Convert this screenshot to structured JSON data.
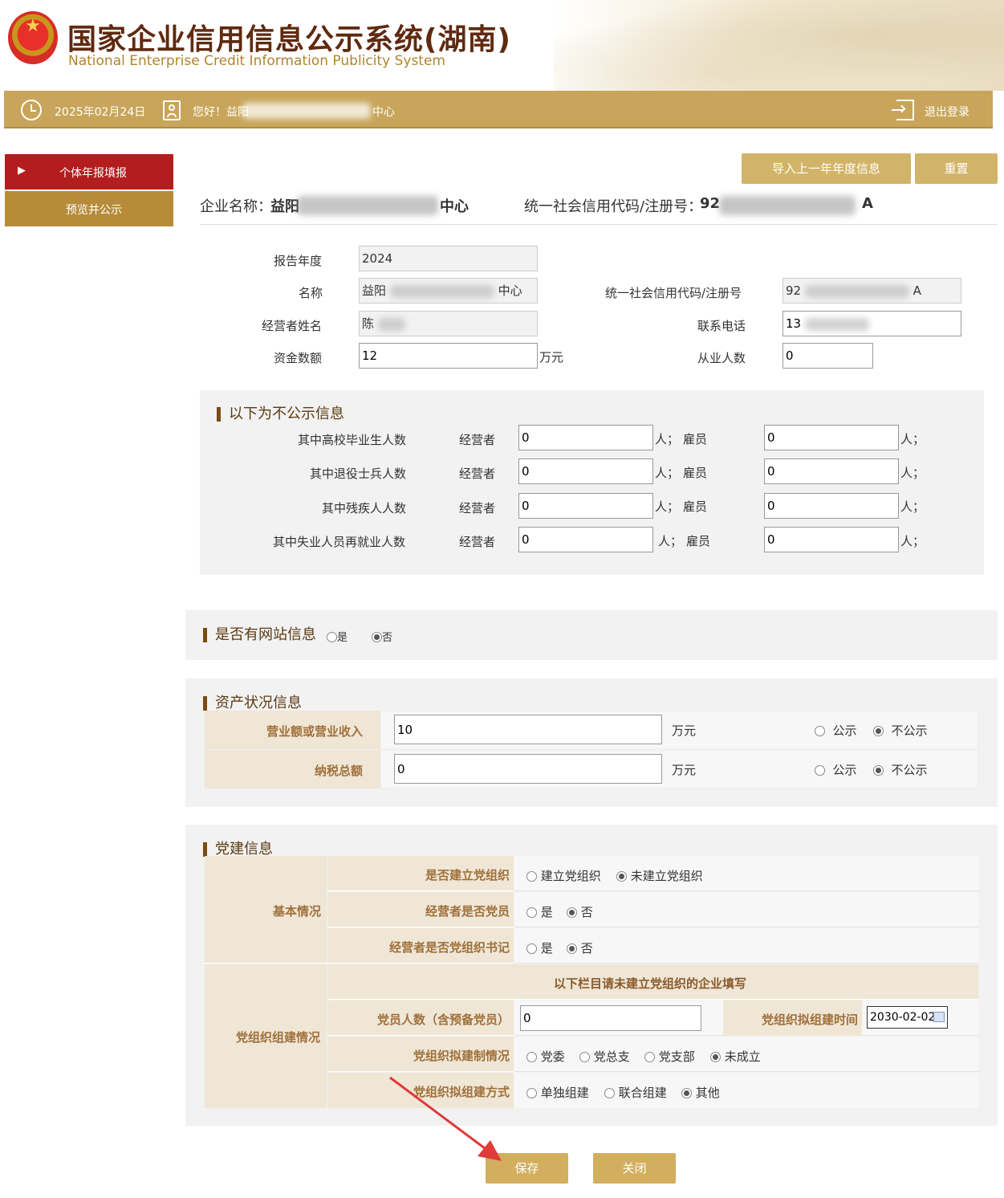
{
  "header": {
    "title_cn": "国家企业信用信息公示系统(湖南)",
    "title_en": "National Enterprise Credit Information Publicity System"
  },
  "topbar": {
    "date": "2025年02月24日",
    "greeting_prefix": "您好！益阳",
    "greeting_suffix": "中心",
    "logout": "退出登录"
  },
  "sidebar": {
    "items": [
      {
        "label": "个体年报填报"
      },
      {
        "label": "预览并公示"
      }
    ]
  },
  "actions": {
    "import_prev": "导入上一年年度信息",
    "reset": "重置",
    "save": "保存",
    "close": "关闭"
  },
  "entity": {
    "name_label": "企业名称：",
    "name_prefix": "益阳",
    "name_suffix": "中心",
    "code_label": "统一社会信用代码/注册号：",
    "code_prefix": "92",
    "code_suffix": "A"
  },
  "form": {
    "report_year_label": "报告年度",
    "report_year": "2024",
    "name_label": "名称",
    "name_prefix": "益阳",
    "name_suffix": "中心",
    "code_label": "统一社会信用代码/注册号",
    "code_prefix": "92",
    "code_suffix": "A",
    "operator_label": "经营者姓名",
    "operator_value": "陈",
    "phone_label": "联系电话",
    "phone_value": "13",
    "capital_label": "资金数额",
    "capital_value": "12",
    "capital_unit": "万元",
    "employees_label": "从业人数",
    "employees_value": "0"
  },
  "non_public": {
    "title": "以下为不公示信息",
    "operator_label": "经营者",
    "unit_sep": "人；",
    "employee_label": "雇员",
    "unit_end": "人；",
    "rows": [
      {
        "label": "其中高校毕业生人数",
        "operator": "0",
        "employee": "0"
      },
      {
        "label": "其中退役士兵人数",
        "operator": "0",
        "employee": "0"
      },
      {
        "label": "其中残疾人人数",
        "operator": "0",
        "employee": "0"
      },
      {
        "label": "其中失业人员再就业人数",
        "operator": "0",
        "employee": "0"
      }
    ]
  },
  "website": {
    "title": "是否有网站信息",
    "yes": "是",
    "no": "否",
    "selected": "否"
  },
  "assets": {
    "title": "资产状况信息",
    "unit": "万元",
    "public": "公示",
    "not_public": "不公示",
    "rows": [
      {
        "label": "营业额或营业收入",
        "value": "10",
        "selected": "不公示"
      },
      {
        "label": "纳税总额",
        "value": "0",
        "selected": "不公示"
      }
    ]
  },
  "party": {
    "title": "党建信息",
    "basic_label": "基本情况",
    "org_label": "党组织组建情况",
    "established_label": "是否建立党组织",
    "established_opts": [
      "建立党组织",
      "未建立党组织"
    ],
    "established_selected": "未建立党组织",
    "is_member_label": "经营者是否党员",
    "is_secretary_label": "经营者是否党组织书记",
    "yes": "是",
    "no": "否",
    "is_member_selected": "否",
    "is_secretary_selected": "否",
    "notice": "以下栏目请未建立党组织的企业填写",
    "members_label": "党员人数（含预备党员）",
    "members_value": "0",
    "plan_time_label": "党组织拟组建时间",
    "plan_time_value": "2030-02-02",
    "plan_type_label": "党组织拟建制情况",
    "plan_type_opts": [
      "党委",
      "党总支",
      "党支部",
      "未成立"
    ],
    "plan_type_selected": "未成立",
    "plan_method_label": "党组织拟组建方式",
    "plan_method_opts": [
      "单独组建",
      "联合组建",
      "其他"
    ],
    "plan_method_selected": "其他"
  },
  "colors": {
    "gold": "#c8a55a",
    "red": "#b41d1d",
    "annotation_arrow": "#e03a3a"
  }
}
